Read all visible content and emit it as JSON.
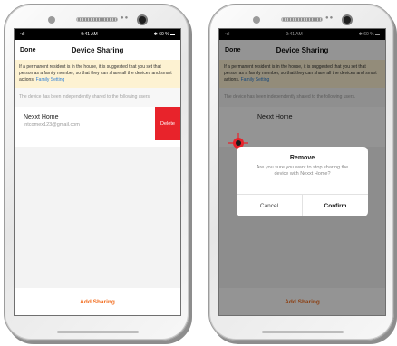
{
  "status_bar": {
    "signal": "•ıll",
    "time": "9:41 AM",
    "battery": "✱ 60 % ▬"
  },
  "nav": {
    "done_label": "Done",
    "title": "Device Sharing"
  },
  "notice": {
    "text": "If a permanent resident is in the house, it is suggested that you set that person as a family member, so that they can share all the devices and smart actions.",
    "link_label": "Family Setting"
  },
  "shared_label": "The device has been independently shared to the following users.",
  "user": {
    "name": "Nexxt Home",
    "email": "intcomex123@gmail.com"
  },
  "delete_label": "Delete",
  "add_sharing_label": "Add Sharing",
  "dialog": {
    "title": "Remove",
    "message": "Are you sure you want to stop sharing the device with Nexxt Home?",
    "cancel_label": "Cancel",
    "confirm_label": "Confirm"
  },
  "colors": {
    "accent": "#f26d1f",
    "delete": "#e8232b",
    "notice_bg": "#fdf2d2",
    "link": "#2f7fd6"
  },
  "icons": [
    "camera-icon",
    "touch-gesture-icon"
  ]
}
